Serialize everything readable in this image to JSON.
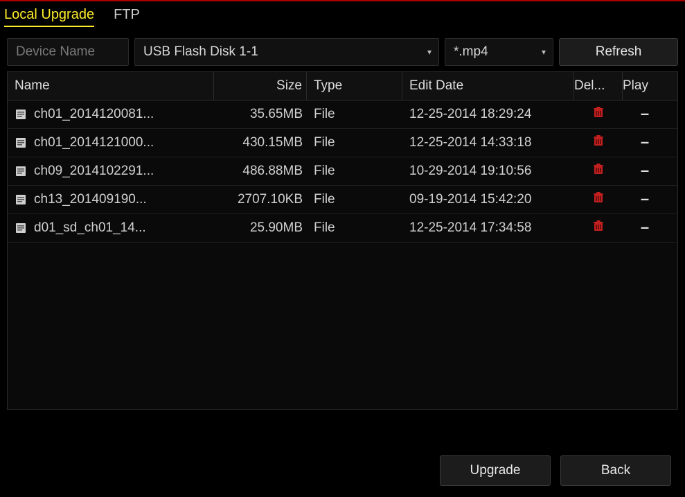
{
  "tabs": {
    "local_upgrade": "Local Upgrade",
    "ftp": "FTP"
  },
  "controls": {
    "device_label": "Device Name",
    "device_value": "USB Flash Disk 1-1",
    "filter_value": "*.mp4",
    "refresh_label": "Refresh"
  },
  "table": {
    "headers": {
      "name": "Name",
      "size": "Size",
      "type": "Type",
      "edit_date": "Edit Date",
      "delete": "Del...",
      "play": "Play"
    },
    "rows": [
      {
        "name": "ch01_2014120081...",
        "size": "35.65MB",
        "type": "File",
        "edit_date": "12-25-2014 18:29:24",
        "play": "–"
      },
      {
        "name": "ch01_2014121000...",
        "size": "430.15MB",
        "type": "File",
        "edit_date": "12-25-2014 14:33:18",
        "play": "–"
      },
      {
        "name": "ch09_2014102291...",
        "size": "486.88MB",
        "type": "File",
        "edit_date": "10-29-2014 19:10:56",
        "play": "–"
      },
      {
        "name": "ch13_201409190...",
        "size": "2707.10KB",
        "type": "File",
        "edit_date": "09-19-2014 15:42:20",
        "play": "–"
      },
      {
        "name": "d01_sd_ch01_14...",
        "size": "25.90MB",
        "type": "File",
        "edit_date": "12-25-2014 17:34:58",
        "play": "–"
      }
    ]
  },
  "footer": {
    "upgrade": "Upgrade",
    "back": "Back"
  }
}
